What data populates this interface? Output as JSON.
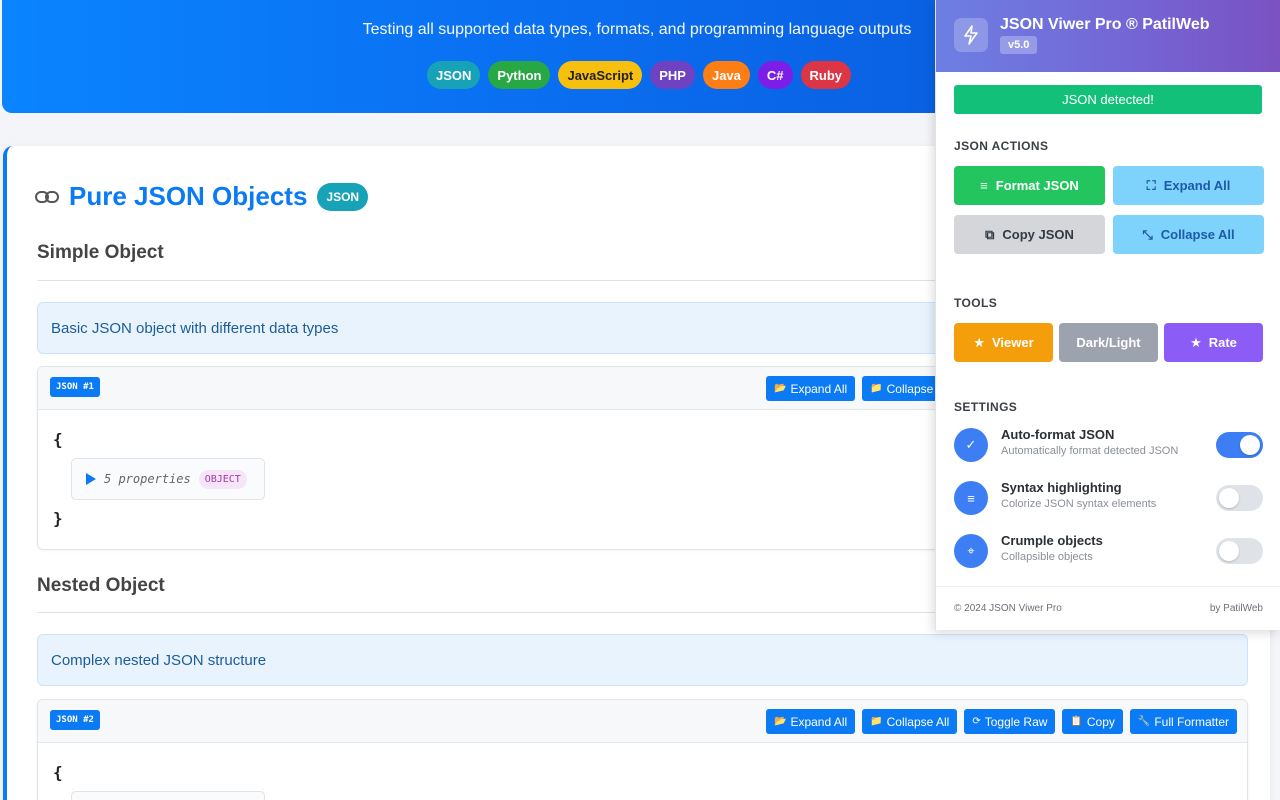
{
  "hero": {
    "subtitle": "Testing all supported data types, formats, and programming language outputs",
    "languages": [
      {
        "label": "JSON",
        "color": "#17a2b8",
        "text": "#ffffff"
      },
      {
        "label": "Python",
        "color": "#28a745",
        "text": "#ffffff"
      },
      {
        "label": "JavaScript",
        "color": "#f7c00f",
        "text": "#222222"
      },
      {
        "label": "PHP",
        "color": "#6f42c1",
        "text": "#ffffff"
      },
      {
        "label": "Java",
        "color": "#fd7e14",
        "text": "#ffffff"
      },
      {
        "label": "C#",
        "color": "#7c1ee8",
        "text": "#ffffff"
      },
      {
        "label": "Ruby",
        "color": "#dc3545",
        "text": "#ffffff"
      }
    ]
  },
  "section": {
    "title": "Pure JSON Objects",
    "badge": "JSON",
    "blocks": [
      {
        "heading": "Simple Object",
        "description": "Basic JSON object with different data types",
        "tag": "JSON #1",
        "buttons": [
          "Expand All",
          "Collapse All"
        ],
        "open_brace": "{",
        "close_brace": "}",
        "summary": "5 properties",
        "type_badge": "OBJECT"
      },
      {
        "heading": "Nested Object",
        "description": "Complex nested JSON structure",
        "tag": "JSON #2",
        "buttons": [
          "Expand All",
          "Collapse All",
          "Toggle Raw",
          "Copy",
          "Full Formatter"
        ],
        "open_brace": "{"
      }
    ]
  },
  "popup": {
    "title": "JSON Viwer Pro ® PatilWeb",
    "version": "v5.0",
    "status": "JSON detected!",
    "actions_label": "JSON ACTIONS",
    "actions": [
      {
        "label": "Format JSON",
        "icon": "lines-icon",
        "bg": "#22c55e",
        "fg": "#ffffff"
      },
      {
        "label": "Expand All",
        "icon": "expand-icon",
        "bg": "#7dd3fc",
        "fg": "#1e5aa8"
      },
      {
        "label": "Copy JSON",
        "icon": "copy-icon",
        "bg": "#d4d6da",
        "fg": "#333a44"
      },
      {
        "label": "Collapse All",
        "icon": "collapse-icon",
        "bg": "#7dd3fc",
        "fg": "#1e5aa8"
      }
    ],
    "tools_label": "TOOLS",
    "tools": [
      {
        "label": "Viewer",
        "icon": "star-icon",
        "bg": "#f59e0b"
      },
      {
        "label": "Dark/Light",
        "icon": "",
        "bg": "#9ca3af"
      },
      {
        "label": "Rate",
        "icon": "star-icon",
        "bg": "#8b5cf6"
      }
    ],
    "settings_label": "SETTINGS",
    "settings": [
      {
        "name": "Auto-format JSON",
        "desc": "Automatically format detected JSON",
        "on": true,
        "icon": "check-icon"
      },
      {
        "name": "Syntax highlighting",
        "desc": "Colorize JSON syntax elements",
        "on": false,
        "icon": "lines-icon"
      },
      {
        "name": "Crumple objects",
        "desc": "Collapsible objects",
        "on": false,
        "icon": "crosshair-icon"
      }
    ],
    "footer_left": "© 2024 JSON Viwer Pro",
    "footer_right": "by PatilWeb"
  }
}
